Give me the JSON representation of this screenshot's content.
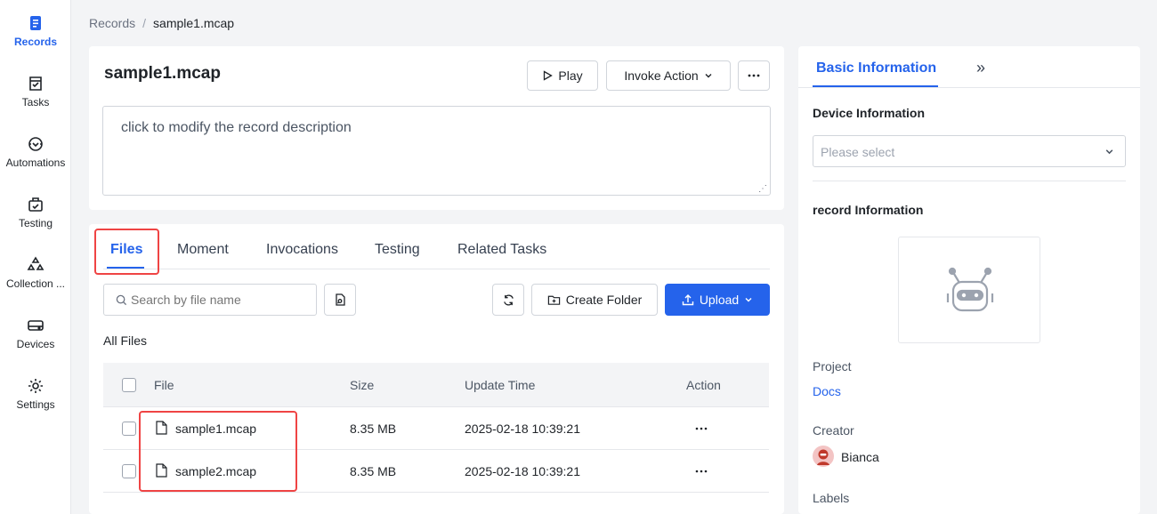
{
  "sidebar": {
    "items": [
      {
        "label": "Records"
      },
      {
        "label": "Tasks"
      },
      {
        "label": "Automations"
      },
      {
        "label": "Testing"
      },
      {
        "label": "Collection ..."
      },
      {
        "label": "Devices"
      },
      {
        "label": "Settings"
      }
    ]
  },
  "breadcrumb": {
    "root": "Records",
    "separator": "/",
    "current": "sample1.mcap"
  },
  "record": {
    "title": "sample1.mcap",
    "play_label": "Play",
    "invoke_label": "Invoke Action",
    "description_placeholder": "click to modify the record description"
  },
  "tabs": [
    {
      "label": "Files"
    },
    {
      "label": "Moment"
    },
    {
      "label": "Invocations"
    },
    {
      "label": "Testing"
    },
    {
      "label": "Related Tasks"
    }
  ],
  "files": {
    "search_placeholder": "Search by file name",
    "create_folder_label": "Create Folder",
    "upload_label": "Upload",
    "section_label": "All Files",
    "columns": {
      "file": "File",
      "size": "Size",
      "update_time": "Update Time",
      "action": "Action"
    },
    "rows": [
      {
        "name": "sample1.mcap",
        "size": "8.35 MB",
        "time": "2025-02-18 10:39:21"
      },
      {
        "name": "sample2.mcap",
        "size": "8.35 MB",
        "time": "2025-02-18 10:39:21"
      }
    ]
  },
  "info": {
    "tab_label": "Basic Information",
    "expand_glyph": "»",
    "device_heading": "Device Information",
    "device_placeholder": "Please select",
    "record_heading": "record Information",
    "project_label": "Project",
    "project_value": "Docs",
    "creator_label": "Creator",
    "creator_value": "Bianca",
    "labels_label": "Labels"
  },
  "colors": {
    "accent": "#2563eb",
    "highlight": "#ef4444"
  }
}
